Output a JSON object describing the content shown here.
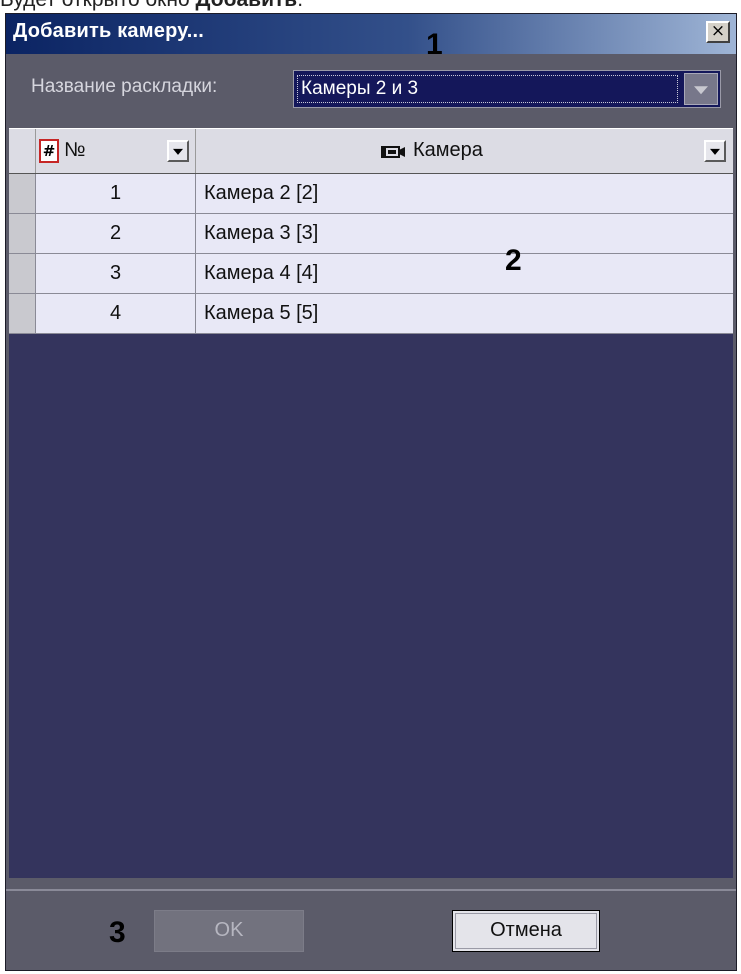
{
  "intro_text": {
    "before": "Будет открыто окно ",
    "bold": "Добавить",
    "after": "."
  },
  "dialog": {
    "title": "Добавить камеру...",
    "close_label": "×"
  },
  "markers": {
    "m1": "1",
    "m2": "2",
    "m3": "3"
  },
  "layout": {
    "label": "Название раскладки:",
    "value": "Камеры 2 и 3"
  },
  "grid": {
    "columns": {
      "num": "№",
      "camera": "Камера"
    },
    "rows": [
      {
        "num": "1",
        "camera": "Камера 2 [2]"
      },
      {
        "num": "2",
        "camera": "Камера 3 [3]"
      },
      {
        "num": "3",
        "camera": "Камера 4 [4]"
      },
      {
        "num": "4",
        "camera": "Камера 5 [5]"
      }
    ]
  },
  "buttons": {
    "ok": "OK",
    "cancel": "Отмена"
  },
  "colors": {
    "title_gradient_start": "#0b2463",
    "dialog_bg": "#5b5b69",
    "grid_bg": "#34345d",
    "row_bg": "#e8e8f6",
    "select_bg": "#14175a"
  }
}
